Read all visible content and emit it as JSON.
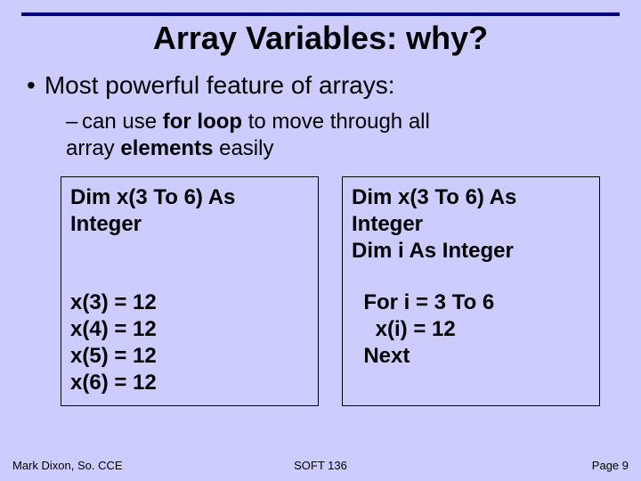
{
  "title": "Array Variables: why?",
  "bullet": "Most powerful feature of arrays:",
  "sub_pre": "can use ",
  "sub_bold1": "for loop",
  "sub_mid": " to move through all\narray ",
  "sub_bold2": "elements",
  "sub_post": " easily",
  "box_left": {
    "l1": "Dim x(3 To 6) As",
    "l2": "Integer",
    "l3": "x(3) = 12",
    "l4": "x(4) = 12",
    "l5": "x(5) = 12",
    "l6": "x(6) = 12"
  },
  "box_right": {
    "l1": "Dim x(3 To 6) As",
    "l2": "Integer",
    "l3": "Dim i As Integer",
    "l4": "  For i = 3 To 6",
    "l5": "    x(i) = 12",
    "l6": "  Next"
  },
  "footer": {
    "left": "Mark Dixon, So. CCE",
    "center": "SOFT 136",
    "right": "Page 9"
  }
}
